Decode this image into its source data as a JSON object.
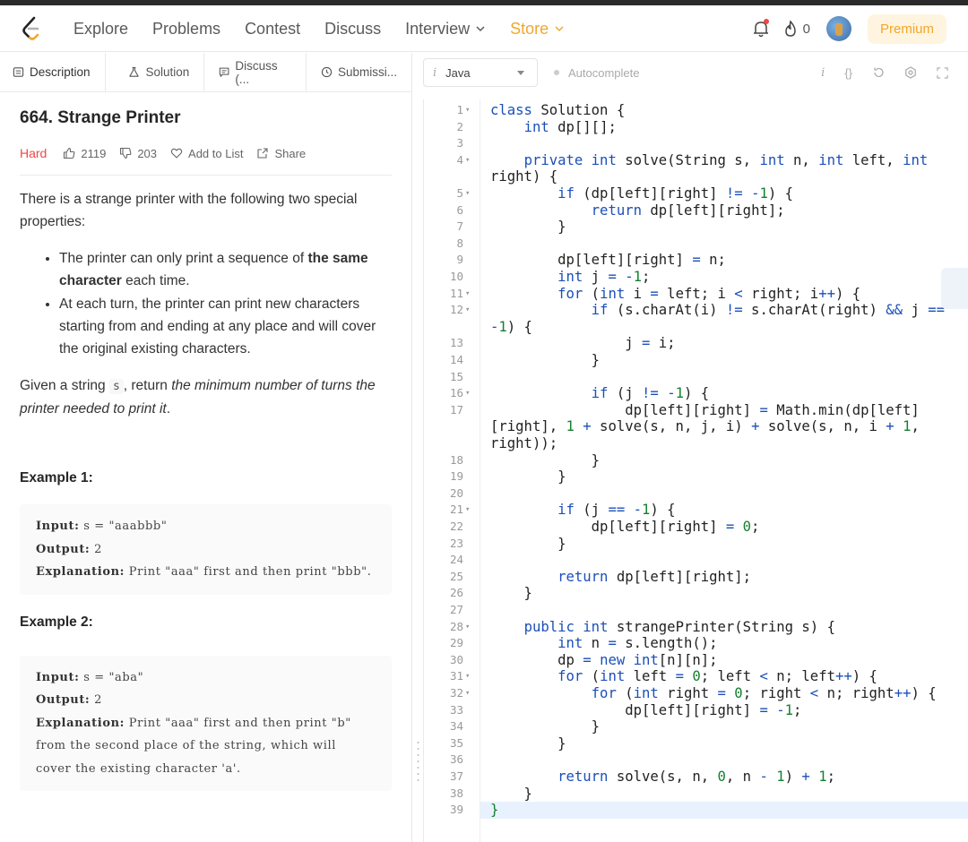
{
  "nav": {
    "links": [
      "Explore",
      "Problems",
      "Contest",
      "Discuss",
      "Interview",
      "Store"
    ],
    "notifications": "0",
    "premium": "Premium"
  },
  "tabs": {
    "description": "Description",
    "solution": "Solution",
    "discuss": "Discuss (...",
    "submissions": "Submissi..."
  },
  "problem": {
    "title": "664. Strange Printer",
    "difficulty": "Hard",
    "likes": "2119",
    "dislikes": "203",
    "add_to_list": "Add to List",
    "share": "Share",
    "intro": "There is a strange printer with the following two special properties:",
    "bullet1_pre": "The printer can only print a sequence of ",
    "bullet1_bold": "the same character",
    "bullet1_post": " each time.",
    "bullet2": "At each turn, the printer can print new characters starting from and ending at any place and will cover the original existing characters.",
    "given_pre": "Given a string ",
    "given_code": "s",
    "given_mid": ", return ",
    "given_em": "the minimum number of turns the printer needed to print it",
    "given_post": ".",
    "ex1_title": "Example 1:",
    "ex1_input_label": "Input:",
    "ex1_input": "s = \"aaabbb\"",
    "ex1_output_label": "Output:",
    "ex1_output": "2",
    "ex1_expl_label": "Explanation:",
    "ex1_expl": "Print \"aaa\" first and then print \"bbb\".",
    "ex2_title": "Example 2:",
    "ex2_input_label": "Input:",
    "ex2_input": "s = \"aba\"",
    "ex2_output_label": "Output:",
    "ex2_output": "2",
    "ex2_expl_label": "Explanation:",
    "ex2_expl": "Print \"aaa\" first and then print \"b\" from the second place of the string, which will cover the existing character 'a'."
  },
  "editor": {
    "language_icon": "i",
    "language": "Java",
    "autocomplete": "Autocomplete",
    "tool_info": "i",
    "tool_braces": "{}"
  },
  "code": [
    {
      "n": "1",
      "f": true,
      "t": "class Solution {"
    },
    {
      "n": "2",
      "f": false,
      "t": "    int dp[][];"
    },
    {
      "n": "3",
      "f": false,
      "t": ""
    },
    {
      "n": "4",
      "f": true,
      "t": "    private int solve(String s, int n, int left, int"
    },
    {
      "n": "",
      "f": false,
      "t": "right) {"
    },
    {
      "n": "5",
      "f": true,
      "t": "        if (dp[left][right] != -1) {"
    },
    {
      "n": "6",
      "f": false,
      "t": "            return dp[left][right];"
    },
    {
      "n": "7",
      "f": false,
      "t": "        }"
    },
    {
      "n": "8",
      "f": false,
      "t": ""
    },
    {
      "n": "9",
      "f": false,
      "t": "        dp[left][right] = n;"
    },
    {
      "n": "10",
      "f": false,
      "t": "        int j = -1;"
    },
    {
      "n": "11",
      "f": true,
      "t": "        for (int i = left; i < right; i++) {"
    },
    {
      "n": "12",
      "f": true,
      "t": "            if (s.charAt(i) != s.charAt(right) && j =="
    },
    {
      "n": "",
      "f": false,
      "t": "-1) {"
    },
    {
      "n": "13",
      "f": false,
      "t": "                j = i;"
    },
    {
      "n": "14",
      "f": false,
      "t": "            }"
    },
    {
      "n": "15",
      "f": false,
      "t": ""
    },
    {
      "n": "16",
      "f": true,
      "t": "            if (j != -1) {"
    },
    {
      "n": "17",
      "f": false,
      "t": "                dp[left][right] = Math.min(dp[left]"
    },
    {
      "n": "",
      "f": false,
      "t": "[right], 1 + solve(s, n, j, i) + solve(s, n, i + 1,"
    },
    {
      "n": "",
      "f": false,
      "t": "right));"
    },
    {
      "n": "18",
      "f": false,
      "t": "            }"
    },
    {
      "n": "19",
      "f": false,
      "t": "        }"
    },
    {
      "n": "20",
      "f": false,
      "t": ""
    },
    {
      "n": "21",
      "f": true,
      "t": "        if (j == -1) {"
    },
    {
      "n": "22",
      "f": false,
      "t": "            dp[left][right] = 0;"
    },
    {
      "n": "23",
      "f": false,
      "t": "        }"
    },
    {
      "n": "24",
      "f": false,
      "t": ""
    },
    {
      "n": "25",
      "f": false,
      "t": "        return dp[left][right];"
    },
    {
      "n": "26",
      "f": false,
      "t": "    }"
    },
    {
      "n": "27",
      "f": false,
      "t": ""
    },
    {
      "n": "28",
      "f": true,
      "t": "    public int strangePrinter(String s) {"
    },
    {
      "n": "29",
      "f": false,
      "t": "        int n = s.length();"
    },
    {
      "n": "30",
      "f": false,
      "t": "        dp = new int[n][n];"
    },
    {
      "n": "31",
      "f": true,
      "t": "        for (int left = 0; left < n; left++) {"
    },
    {
      "n": "32",
      "f": true,
      "t": "            for (int right = 0; right < n; right++) {"
    },
    {
      "n": "33",
      "f": false,
      "t": "                dp[left][right] = -1;"
    },
    {
      "n": "34",
      "f": false,
      "t": "            }"
    },
    {
      "n": "35",
      "f": false,
      "t": "        }"
    },
    {
      "n": "36",
      "f": false,
      "t": ""
    },
    {
      "n": "37",
      "f": false,
      "t": "        return solve(s, n, 0, n - 1) + 1;"
    },
    {
      "n": "38",
      "f": false,
      "t": "    }"
    },
    {
      "n": "39",
      "f": false,
      "t": "}"
    }
  ],
  "colors": {
    "store": "#f0a72c",
    "hard": "#ef4743",
    "keyword": "#1b4fb8",
    "number": "#14802f"
  }
}
